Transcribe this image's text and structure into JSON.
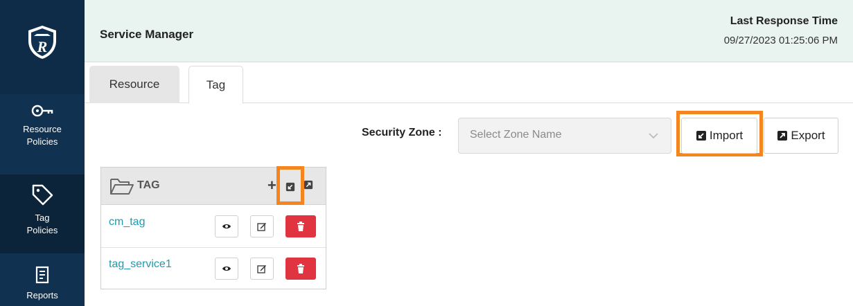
{
  "sidebar": {
    "logo_icon": "ranger-shield-logo",
    "items": [
      {
        "label_1": "Resource",
        "label_2": "Policies",
        "icon": "key-icon",
        "active": false
      },
      {
        "label_1": "Tag",
        "label_2": "Policies",
        "icon": "tag-icon",
        "active": true
      },
      {
        "label_1": "Reports",
        "icon": "report-icon",
        "active": false
      }
    ]
  },
  "header": {
    "title": "Service Manager",
    "response_label": "Last Response Time",
    "response_value": "09/27/2023 01:25:06 PM"
  },
  "tabs": [
    {
      "label": "Resource",
      "active": false
    },
    {
      "label": "Tag",
      "active": true
    }
  ],
  "toolbar": {
    "zone_label": "Security Zone :",
    "zone_placeholder": "Select Zone Name",
    "import_label": "Import",
    "export_label": "Export"
  },
  "tag_panel": {
    "title": "TAG",
    "rows": [
      {
        "name": "cm_tag"
      },
      {
        "name": "tag_service1"
      }
    ]
  },
  "colors": {
    "sidebar": "#10314f",
    "header_bg": "#e9f3f0",
    "link": "#1b9bb0",
    "delete": "#e03441",
    "highlight": "#f5861f"
  }
}
